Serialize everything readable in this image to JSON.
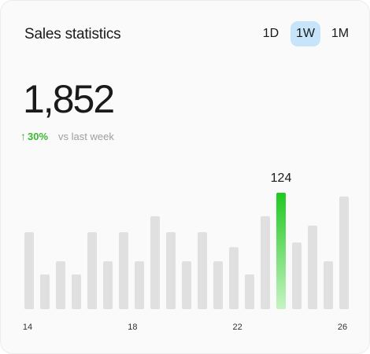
{
  "header": {
    "title": "Sales statistics",
    "ranges": [
      "1D",
      "1W",
      "1M"
    ],
    "active_range": "1W"
  },
  "summary": {
    "value": "1,852",
    "change_percent": "30%",
    "change_label": "vs last week"
  },
  "colors": {
    "bar": "#e0e0e0",
    "highlight_top": "#20c820",
    "highlight_bottom": "#c7f4c4",
    "active_tab": "#c6e5fb",
    "positive": "#3cb832"
  },
  "chart_data": {
    "type": "bar",
    "x": [
      14,
      14.5,
      15,
      15.5,
      16,
      16.5,
      17,
      17.5,
      18,
      18.5,
      19,
      19.5,
      20,
      20.5,
      21,
      21.5,
      22,
      22.5,
      23,
      23.5,
      24,
      24.5,
      25,
      25.5,
      26
    ],
    "values": [
      82,
      37,
      51,
      37,
      82,
      51,
      82,
      51,
      99,
      82,
      51,
      82,
      51,
      66,
      37,
      99,
      124,
      71,
      89,
      51,
      120
    ],
    "xticks": [
      14,
      18,
      22,
      26
    ],
    "highlight_index": 16,
    "highlight_label": "124",
    "ylim": [
      0,
      124
    ]
  }
}
